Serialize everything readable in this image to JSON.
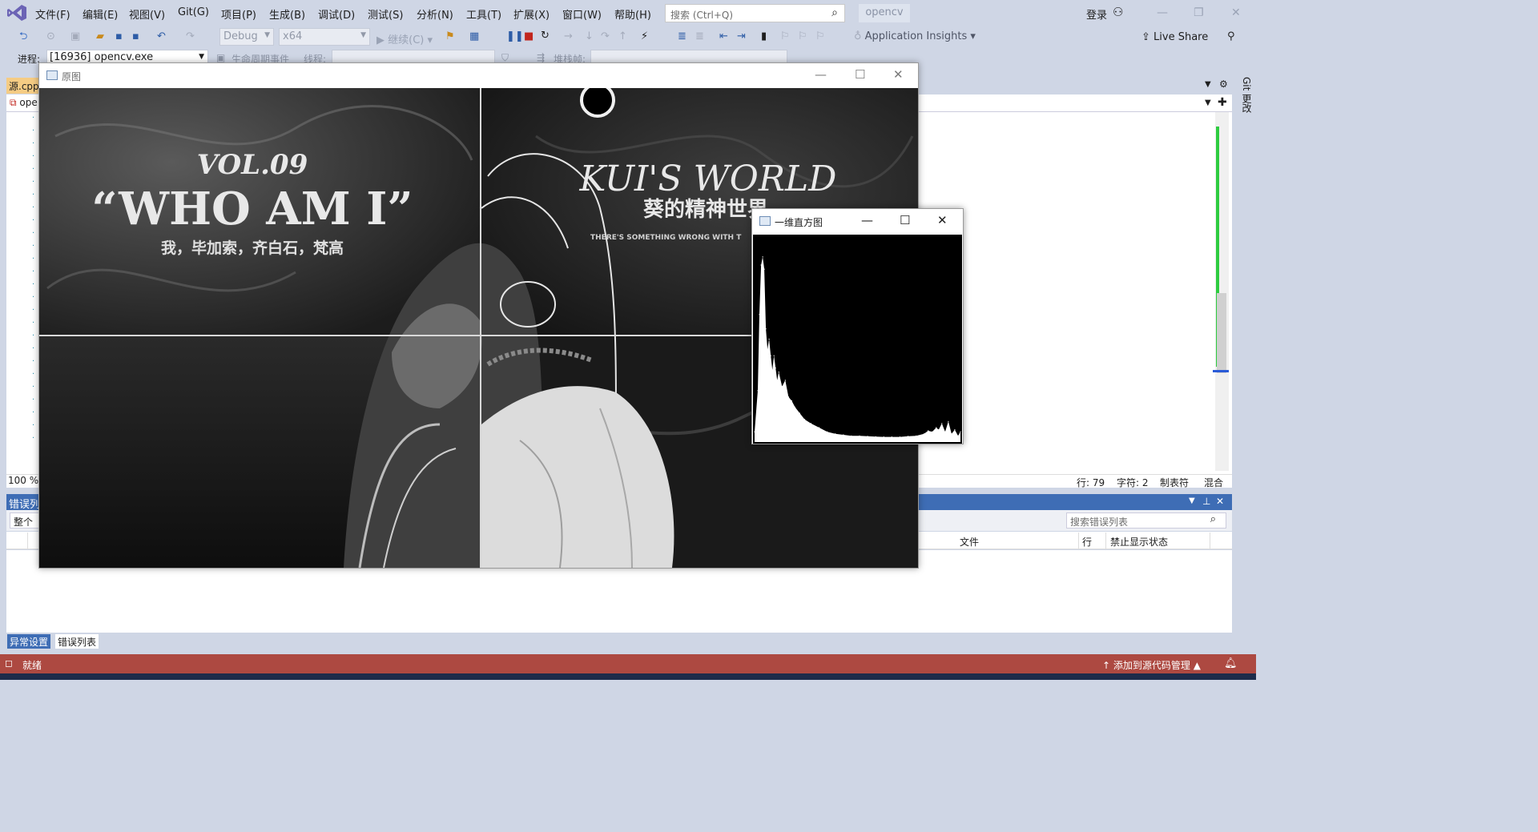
{
  "menu": [
    "文件(F)",
    "编辑(E)",
    "视图(V)",
    "Git(G)",
    "项目(P)",
    "生成(B)",
    "调试(D)",
    "测试(S)",
    "分析(N)",
    "工具(T)",
    "扩展(X)",
    "窗口(W)",
    "帮助(H)"
  ],
  "search": {
    "placeholder": "搜索 (Ctrl+Q)"
  },
  "solution_name": "opencv",
  "login_label": "登录",
  "toolbar": {
    "config": "Debug",
    "platform": "x64",
    "continue_label": "继续(C)",
    "app_insights": "Application Insights",
    "live_share": "Live Share"
  },
  "debug_location": {
    "process_label": "进程:",
    "process_value": "[16936] opencv.exe",
    "lifecycle_label": "生命周期事件",
    "thread_label": "线程:",
    "stack_label": "堆栈帧:"
  },
  "editor": {
    "tab_label": "源.cpp",
    "nav_label": "ope",
    "zoom": "100 %",
    "line_status": "行: 79",
    "char_status": "字符: 2",
    "tab_mode": "制表符",
    "eol_mode": "混合",
    "side_tab": "Git 更改"
  },
  "error_list": {
    "title": "错误列",
    "scope": "整个解",
    "search_placeholder": "搜索错误列表",
    "columns": [
      "文件",
      "行",
      "禁止显示状态"
    ]
  },
  "bottom_tabs": [
    "异常设置",
    "错误列表"
  ],
  "statusbar": {
    "ready": "就绪",
    "source_control": "添加到源代码管理"
  },
  "windows": {
    "original": {
      "title": "原图",
      "texts": {
        "vol": "VOL.09",
        "headline": "“WHO AM I”",
        "subline": "我，毕加索，齐白石，梵高",
        "kui": "KUI'S WORLD",
        "kui_cn": "葵的精神世界",
        "kui_small": "THERE'S SOMETHING WRONG WITH T"
      }
    },
    "histogram": {
      "title": "一维直方图"
    }
  },
  "chart_data": {
    "type": "area",
    "title": "",
    "xlabel": "",
    "ylabel": "",
    "xlim": [
      0,
      255
    ],
    "ylim": [
      0,
      1
    ],
    "x": [
      0,
      4,
      6,
      8,
      10,
      12,
      14,
      16,
      18,
      20,
      22,
      24,
      26,
      28,
      30,
      34,
      38,
      42,
      46,
      50,
      56,
      62,
      70,
      80,
      90,
      100,
      110,
      120,
      130,
      140,
      150,
      160,
      170,
      180,
      190,
      200,
      210,
      215,
      220,
      225,
      228,
      232,
      236,
      240,
      244,
      248,
      252,
      255
    ],
    "values": [
      0.05,
      0.25,
      0.62,
      0.86,
      0.9,
      0.84,
      0.55,
      0.45,
      0.5,
      0.42,
      0.35,
      0.42,
      0.36,
      0.3,
      0.34,
      0.27,
      0.3,
      0.22,
      0.2,
      0.17,
      0.14,
      0.11,
      0.09,
      0.07,
      0.05,
      0.04,
      0.035,
      0.03,
      0.03,
      0.028,
      0.026,
      0.025,
      0.025,
      0.025,
      0.028,
      0.03,
      0.04,
      0.055,
      0.05,
      0.07,
      0.06,
      0.09,
      0.05,
      0.1,
      0.04,
      0.06,
      0.03,
      0.05
    ],
    "grid": false,
    "colors": {
      "background": "#000000",
      "fill": "#ffffff"
    }
  },
  "colors": {
    "chrome": "#cfd6e5",
    "statusbar": "#ad4941",
    "panel_header": "#3e6db5",
    "doc_tab": "#f5cc84"
  }
}
